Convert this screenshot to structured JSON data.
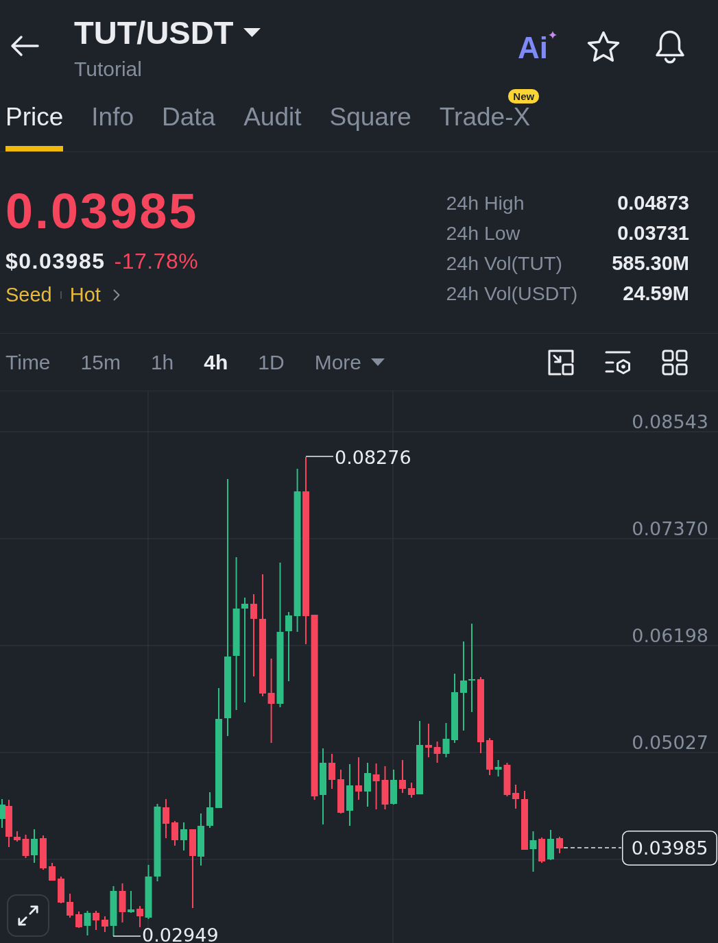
{
  "header": {
    "title": "TUT/USDT",
    "subtitle": "Tutorial",
    "ai_label": "Ai"
  },
  "tabs": [
    {
      "label": "Price",
      "selected": true
    },
    {
      "label": "Info",
      "selected": false
    },
    {
      "label": "Data",
      "selected": false
    },
    {
      "label": "Audit",
      "selected": false
    },
    {
      "label": "Square",
      "selected": false
    },
    {
      "label": "Trade-X",
      "selected": false,
      "badge": "New"
    }
  ],
  "price": {
    "last": "0.03985",
    "usd": "$0.03985",
    "change": "-17.78%",
    "negative": true,
    "tags": [
      "Seed",
      "Hot"
    ]
  },
  "stats": [
    {
      "label": "24h High",
      "value": "0.04873"
    },
    {
      "label": "24h Low",
      "value": "0.03731"
    },
    {
      "label": "24h Vol(TUT)",
      "value": "585.30M"
    },
    {
      "label": "24h Vol(USDT)",
      "value": "24.59M"
    }
  ],
  "intervals": [
    {
      "label": "Time",
      "selected": false,
      "kind": "option"
    },
    {
      "label": "15m",
      "selected": false,
      "kind": "option"
    },
    {
      "label": "1h",
      "selected": false,
      "kind": "option"
    },
    {
      "label": "4h",
      "selected": true,
      "kind": "option"
    },
    {
      "label": "1D",
      "selected": false,
      "kind": "option"
    },
    {
      "label": "More",
      "selected": false,
      "kind": "dropdown"
    }
  ],
  "chart": {
    "axis_labels": [
      "0.08543",
      "0.07370",
      "0.06198",
      "0.05027"
    ],
    "high_label": "0.08276",
    "low_label": "0.02949",
    "last_price_label": "0.03985"
  }
}
